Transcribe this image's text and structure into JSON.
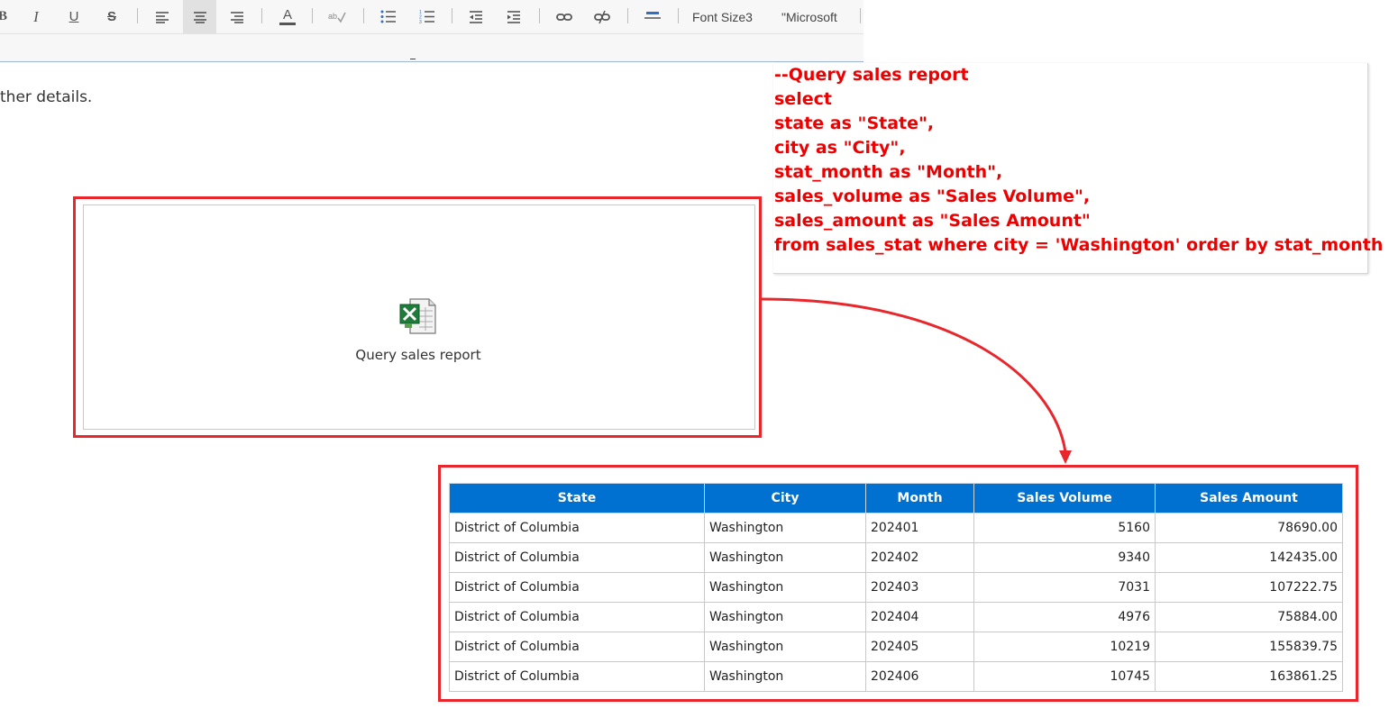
{
  "toolbar": {
    "bold_label": "B",
    "italic_label": "I",
    "underline_label": "U",
    "strike_label": "S",
    "text_color_label": "A",
    "font_size_label": "Font Size3",
    "font_family_label": "\"Microsoft"
  },
  "editor": {
    "body_text": "ther details."
  },
  "sql": {
    "color": "#ee0000",
    "lines": [
      "--Query sales report",
      "select",
      "state as \"State\",",
      "city as \"City\",",
      "stat_month as \"Month\",",
      "sales_volume as \"Sales Volume\",",
      "sales_amount as \"Sales Amount\"",
      "from sales_stat where city = 'Washington' order by stat_month"
    ]
  },
  "attachment": {
    "icon": "excel-file-icon",
    "label": "Query sales report"
  },
  "table": {
    "header_color": "#0070d1",
    "columns": [
      "State",
      "City",
      "Month",
      "Sales Volume",
      "Sales Amount"
    ],
    "rows": [
      [
        "District of Columbia",
        "Washington",
        "202401",
        "5160",
        "78690.00"
      ],
      [
        "District of Columbia",
        "Washington",
        "202402",
        "9340",
        "142435.00"
      ],
      [
        "District of Columbia",
        "Washington",
        "202403",
        "7031",
        "107222.75"
      ],
      [
        "District of Columbia",
        "Washington",
        "202404",
        "4976",
        "75884.00"
      ],
      [
        "District of Columbia",
        "Washington",
        "202405",
        "10219",
        "155839.75"
      ],
      [
        "District of Columbia",
        "Washington",
        "202406",
        "10745",
        "163861.25"
      ]
    ]
  },
  "highlight_color": "#e8262c"
}
